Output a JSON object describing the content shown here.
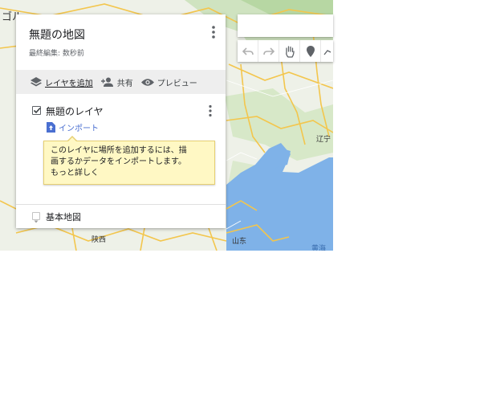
{
  "map": {
    "labels": {
      "top_left": "ゴル",
      "province_1": "辽宁",
      "province_2": "陕西",
      "province_3": "山东",
      "sea": "黄海"
    }
  },
  "panel": {
    "title": "無題の地図",
    "last_edited": "最終編集: 数秒前",
    "actions": {
      "add_layer": "レイヤを追加",
      "share": "共有",
      "preview": "プレビュー"
    },
    "layer": {
      "name": "無題のレイヤ",
      "checked": true,
      "import_label": "インポート"
    },
    "tooltip": {
      "line1": "このレイヤに場所を追加するには、描",
      "line2": "画するかデータをインポートします。",
      "link": "もっと詳しく"
    },
    "base_map_label": "基本地図"
  },
  "colors": {
    "land": "#eaf0e4",
    "sea": "#7fb2e8",
    "road": "#f3c64d",
    "tooltip_bg": "#fff8c4",
    "link_blue": "#4a6fd1"
  }
}
